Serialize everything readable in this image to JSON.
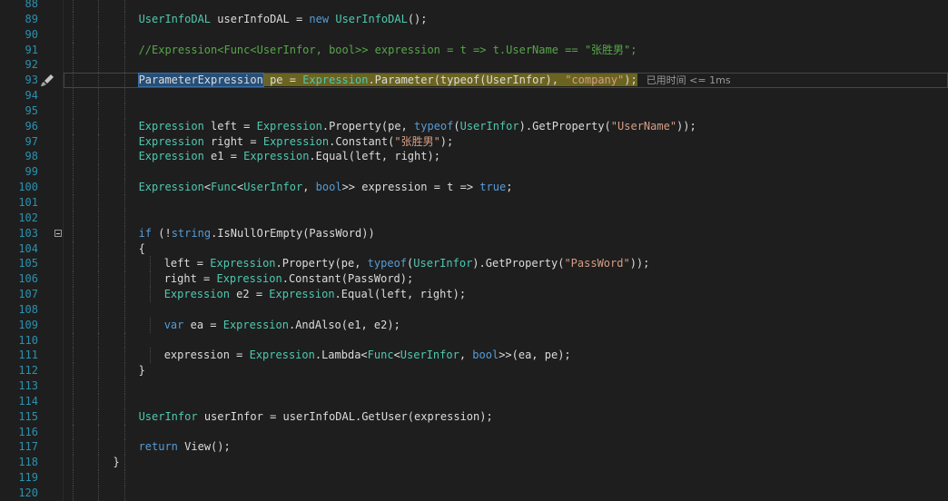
{
  "editor": {
    "lines": [
      {
        "n": "88",
        "indent": 0,
        "tokens": []
      },
      {
        "n": "89",
        "indent": 19,
        "tokens": [
          [
            "type",
            "UserInfoDAL"
          ],
          [
            "plain",
            " userInfoDAL = "
          ],
          [
            "keyword",
            "new"
          ],
          [
            "plain",
            " "
          ],
          [
            "type",
            "UserInfoDAL"
          ],
          [
            "plain",
            "();"
          ]
        ]
      },
      {
        "n": "90",
        "indent": 0,
        "tokens": []
      },
      {
        "n": "91",
        "indent": 19,
        "tokens": [
          [
            "comment",
            "//Expression<Func<UserInfor, bool>> expression = t => t.UserName == \"张胜男\";"
          ]
        ]
      },
      {
        "n": "92",
        "indent": 0,
        "tokens": []
      },
      {
        "n": "93",
        "indent": 19,
        "current": true,
        "tokens": [
          [
            "sel",
            "ParameterExpression"
          ],
          [
            "cur",
            " pe = "
          ],
          [
            "cur",
            "Expression"
          ],
          [
            "cur",
            ".Parameter(typeof(UserInfor), "
          ],
          [
            "cur",
            "\"company\""
          ],
          [
            "cur",
            ");"
          ]
        ],
        "tip": "已用时间 <= 1ms"
      },
      {
        "n": "94",
        "indent": 0,
        "tokens": []
      },
      {
        "n": "95",
        "indent": 0,
        "tokens": []
      },
      {
        "n": "96",
        "indent": 19,
        "tokens": [
          [
            "type",
            "Expression"
          ],
          [
            "plain",
            " left = "
          ],
          [
            "type",
            "Expression"
          ],
          [
            "plain",
            ".Property(pe, "
          ],
          [
            "keyword",
            "typeof"
          ],
          [
            "plain",
            "("
          ],
          [
            "type",
            "UserInfor"
          ],
          [
            "plain",
            ").GetProperty("
          ],
          [
            "string",
            "\"UserName\""
          ],
          [
            "plain",
            "));"
          ]
        ]
      },
      {
        "n": "97",
        "indent": 19,
        "tokens": [
          [
            "type",
            "Expression"
          ],
          [
            "plain",
            " right = "
          ],
          [
            "type",
            "Expression"
          ],
          [
            "plain",
            ".Constant("
          ],
          [
            "string",
            "\"张胜男\""
          ],
          [
            "plain",
            ");"
          ]
        ]
      },
      {
        "n": "98",
        "indent": 19,
        "tokens": [
          [
            "type",
            "Expression"
          ],
          [
            "plain",
            " e1 = "
          ],
          [
            "type",
            "Expression"
          ],
          [
            "plain",
            ".Equal(left, right);"
          ]
        ]
      },
      {
        "n": "99",
        "indent": 0,
        "tokens": []
      },
      {
        "n": "100",
        "indent": 19,
        "tokens": [
          [
            "type",
            "Expression"
          ],
          [
            "plain",
            "<"
          ],
          [
            "type",
            "Func"
          ],
          [
            "plain",
            "<"
          ],
          [
            "type",
            "UserInfor"
          ],
          [
            "plain",
            ", "
          ],
          [
            "keyword",
            "bool"
          ],
          [
            "plain",
            ">> expression = t => "
          ],
          [
            "keyword",
            "true"
          ],
          [
            "plain",
            ";"
          ]
        ]
      },
      {
        "n": "101",
        "indent": 0,
        "tokens": []
      },
      {
        "n": "102",
        "indent": 0,
        "tokens": []
      },
      {
        "n": "103",
        "indent": 19,
        "collapse": true,
        "tokens": [
          [
            "keyword",
            "if"
          ],
          [
            "plain",
            " (!"
          ],
          [
            "keyword",
            "string"
          ],
          [
            "plain",
            ".IsNullOrEmpty(PassWord))"
          ]
        ]
      },
      {
        "n": "104",
        "indent": 19,
        "tokens": [
          [
            "plain",
            "{"
          ]
        ]
      },
      {
        "n": "105",
        "indent": 23,
        "tokens": [
          [
            "plain",
            "left = "
          ],
          [
            "type",
            "Expression"
          ],
          [
            "plain",
            ".Property(pe, "
          ],
          [
            "keyword",
            "typeof"
          ],
          [
            "plain",
            "("
          ],
          [
            "type",
            "UserInfor"
          ],
          [
            "plain",
            ").GetProperty("
          ],
          [
            "string",
            "\"PassWord\""
          ],
          [
            "plain",
            "));"
          ]
        ]
      },
      {
        "n": "106",
        "indent": 23,
        "tokens": [
          [
            "plain",
            "right = "
          ],
          [
            "type",
            "Expression"
          ],
          [
            "plain",
            ".Constant(PassWord);"
          ]
        ]
      },
      {
        "n": "107",
        "indent": 23,
        "tokens": [
          [
            "type",
            "Expression"
          ],
          [
            "plain",
            " e2 = "
          ],
          [
            "type",
            "Expression"
          ],
          [
            "plain",
            ".Equal(left, right);"
          ]
        ]
      },
      {
        "n": "108",
        "indent": 0,
        "tokens": []
      },
      {
        "n": "109",
        "indent": 23,
        "tokens": [
          [
            "keyword",
            "var"
          ],
          [
            "plain",
            " ea = "
          ],
          [
            "type",
            "Expression"
          ],
          [
            "plain",
            ".AndAlso(e1, e2);"
          ]
        ]
      },
      {
        "n": "110",
        "indent": 0,
        "tokens": []
      },
      {
        "n": "111",
        "indent": 23,
        "tokens": [
          [
            "plain",
            "expression = "
          ],
          [
            "type",
            "Expression"
          ],
          [
            "plain",
            ".Lambda<"
          ],
          [
            "type",
            "Func"
          ],
          [
            "plain",
            "<"
          ],
          [
            "type",
            "UserInfor"
          ],
          [
            "plain",
            ", "
          ],
          [
            "keyword",
            "bool"
          ],
          [
            "plain",
            ">>(ea, pe);"
          ]
        ]
      },
      {
        "n": "112",
        "indent": 19,
        "tokens": [
          [
            "plain",
            "}"
          ]
        ]
      },
      {
        "n": "113",
        "indent": 0,
        "tokens": []
      },
      {
        "n": "114",
        "indent": 0,
        "tokens": []
      },
      {
        "n": "115",
        "indent": 19,
        "tokens": [
          [
            "type",
            "UserInfor"
          ],
          [
            "plain",
            " userInfor = userInfoDAL.GetUser(expression);"
          ]
        ]
      },
      {
        "n": "116",
        "indent": 0,
        "tokens": []
      },
      {
        "n": "117",
        "indent": 19,
        "tokens": [
          [
            "keyword",
            "return"
          ],
          [
            "plain",
            " View();"
          ]
        ]
      },
      {
        "n": "118",
        "indent": 15,
        "tokens": [
          [
            "plain",
            "}"
          ]
        ]
      },
      {
        "n": "119",
        "indent": 0,
        "tokens": []
      },
      {
        "n": "120",
        "indent": 0,
        "tokens": []
      }
    ]
  },
  "colors": {
    "background": "#1e1e1e",
    "line_number": "#2b91af",
    "type": "#4ec9b0",
    "keyword": "#569cd6",
    "string": "#d69d85",
    "comment": "#57a64a",
    "selection": "#264f78"
  },
  "icons": {
    "gutter_glyph": "brush-icon",
    "fold_toggle": "collapse-minus-icon"
  }
}
